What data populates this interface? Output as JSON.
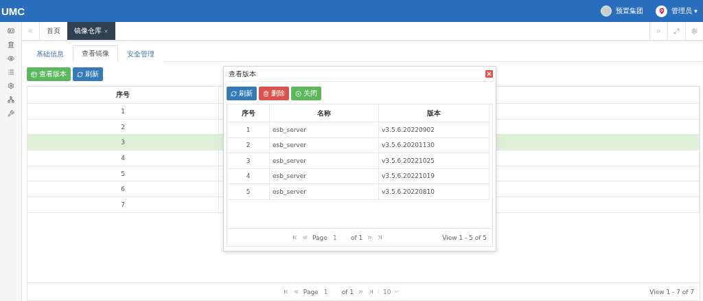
{
  "header": {
    "logo": "UMC",
    "org": "预置集团",
    "user": "管理员"
  },
  "tabs": [
    {
      "label": "首页",
      "selected": false,
      "closable": false
    },
    {
      "label": "镜像仓库",
      "selected": true,
      "closable": true
    }
  ],
  "subtabs": [
    {
      "label": "基础信息",
      "selected": false
    },
    {
      "label": "查看镜像",
      "selected": true
    },
    {
      "label": "安全管理",
      "selected": false
    }
  ],
  "toolbar": [
    {
      "label": "查看版本",
      "kind": "success"
    },
    {
      "label": "刷新",
      "kind": "primary"
    }
  ],
  "table": {
    "columns": [
      "序号"
    ],
    "rows": [
      {
        "cells": [
          "1"
        ],
        "selected": false
      },
      {
        "cells": [
          "2"
        ],
        "selected": false
      },
      {
        "cells": [
          "3"
        ],
        "selected": true
      },
      {
        "cells": [
          "4"
        ],
        "selected": false
      },
      {
        "cells": [
          "5"
        ],
        "selected": false
      },
      {
        "cells": [
          "6"
        ],
        "selected": false
      },
      {
        "cells": [
          "7"
        ],
        "selected": false
      }
    ]
  },
  "pager": {
    "page_label": "Page",
    "page": "1",
    "of": "of 1",
    "page_size": "10",
    "view": "View 1 - 7 of 7"
  },
  "modal": {
    "title": "查看版本",
    "buttons": [
      {
        "label": "刷新",
        "kind": "primary"
      },
      {
        "label": "删除",
        "kind": "danger"
      },
      {
        "label": "关闭",
        "kind": "success"
      }
    ],
    "columns": [
      "序号",
      "名称",
      "版本"
    ],
    "rows": [
      [
        "1",
        "esb_server",
        "v3.5.6.20220902"
      ],
      [
        "2",
        "esb_server",
        "v3.5.6.20201130"
      ],
      [
        "3",
        "esb_server",
        "v3.5.6.20221025"
      ],
      [
        "4",
        "esb_server",
        "v3.5.6.20221019"
      ],
      [
        "5",
        "esb_server",
        "v3.5.6.20220810"
      ]
    ],
    "pager": {
      "page_label": "Page",
      "page": "1",
      "of": "of 1",
      "view": "View 1 - 5 of 5"
    }
  }
}
